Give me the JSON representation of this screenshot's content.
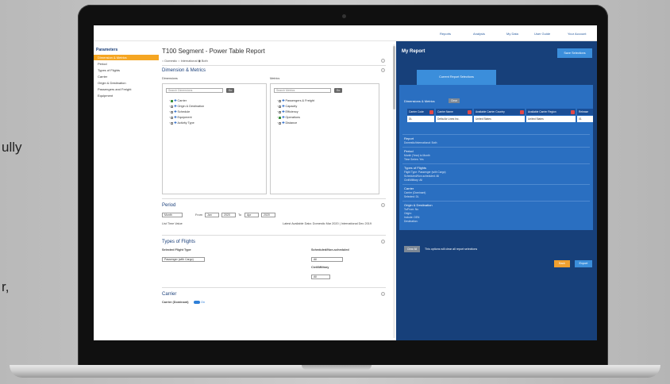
{
  "edge_text": [
    "ully",
    "r,"
  ],
  "topnav": {
    "links": [
      "Reports",
      "Analysis",
      "My Data",
      "User Guide",
      "Your Account"
    ]
  },
  "sidebar": {
    "title": "Parameters",
    "items": [
      "Dimension & Metrics",
      "Period",
      "Types of Flights",
      "Carrier",
      "Origin & Destination",
      "Passengers and Freight",
      "Equipment"
    ]
  },
  "main": {
    "title": "T100 Segment - Power Table Report",
    "radio_options": "○ Domestic  ○ International  ◉ Both",
    "dimension_metrics": {
      "title": "Dimension & Metrics",
      "dimensions_label": "Dimensions",
      "metrics_label": "Metrics",
      "search_dimensions": "Search Dimensions",
      "search_metrics": "Search Metrics",
      "go_label": "Go",
      "dimensions": [
        "Carrier",
        "Origin & Destination",
        "Schedule",
        "Equipment",
        "Activity Type"
      ],
      "metrics": [
        "Passengers & Freight",
        "Capacity",
        "Efficiency",
        "Operations",
        "Distance"
      ]
    },
    "period": {
      "title": "Period",
      "granularity": "Month",
      "from_label": "From",
      "to_label": "To",
      "from_month": "Jan",
      "from_year": "2020",
      "to_month": "Apr",
      "to_year": "2020",
      "list_time_label": "List Time Value",
      "latest_available": "Latest Available Data: Domestic Mar 2020 | International Dec 2019"
    },
    "types_of_flights": {
      "title": "Types of Flights",
      "selected_label": "Selected Flight Type",
      "selected_value": "Passenger (with Cargo)",
      "scheduled_label": "Scheduled/Non-scheduled",
      "scheduled_value": "All",
      "civil_label": "Civil/Military",
      "civil_value": "All"
    },
    "carrier": {
      "title": "Carrier",
      "carrier_label": "Carrier (Dominant)",
      "toggle_state": "On"
    }
  },
  "report": {
    "title": "My Report",
    "save_btn": "Save Selections",
    "tab_label": "Current Report Selections",
    "dm_label": "Dimensions & Metrics",
    "clear_label": "Clear",
    "table_headers": [
      "Carrier Code",
      "Carrier Name",
      "Available Carrier Country",
      "Available Carrier Region",
      "Release"
    ],
    "table_values": [
      "DL",
      "Delta Air Lines Inc.",
      "United States",
      "United States",
      "01"
    ],
    "sections": [
      {
        "title": "Report",
        "lines": [
          "Domestic/International: Both"
        ]
      },
      {
        "title": "Period",
        "lines": [
          "Month (Year) to Month",
          "Time Series: Yes"
        ]
      },
      {
        "title": "Types of Flights",
        "lines": [
          "Flight Type: Passenger (with Cargo)",
          "Scheduled/Non-scheduled: All",
          "Civil/Military: All"
        ]
      },
      {
        "title": "Carrier",
        "lines": [
          "Carrier (Dominant)",
          "Selected: DL"
        ]
      },
      {
        "title": "Origin & Destination",
        "lines": [
          "To/From: No",
          "Origin:",
          "Include: DEN",
          "Destination:"
        ]
      }
    ],
    "clear_all_btn": "Clear All",
    "clear_all_text": "This options will clear all report selections",
    "back_btn": "Back",
    "export_btn": "Export"
  }
}
